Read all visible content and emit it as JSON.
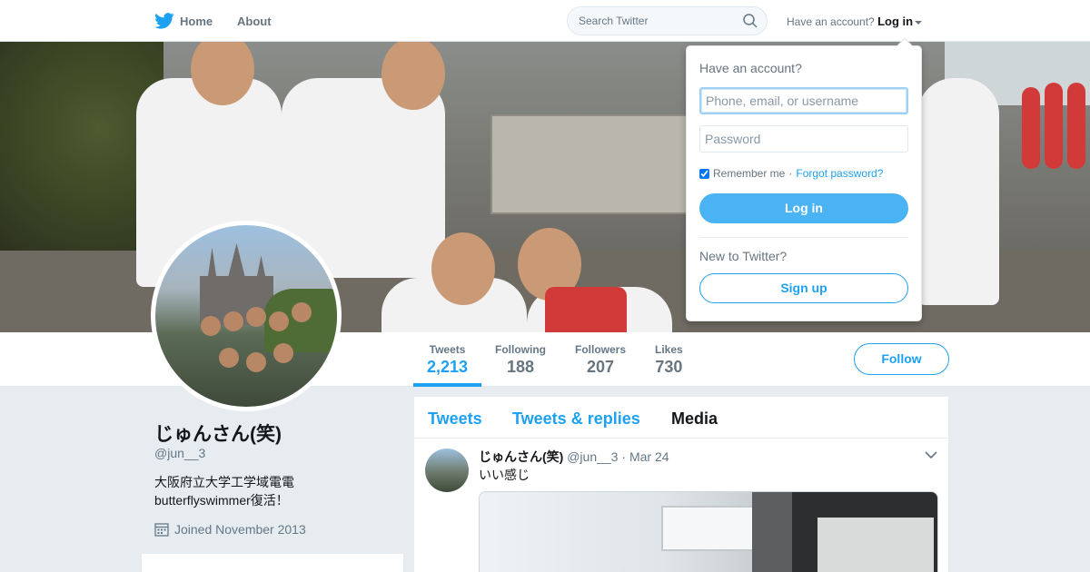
{
  "nav": {
    "home_label": "Home",
    "about_label": "About",
    "search_placeholder": "Search Twitter",
    "have_account_text": "Have an account?",
    "login_label": "Log in"
  },
  "profile": {
    "name": "じゅんさん(笑)",
    "handle": "@jun__3",
    "bio_line1": "大阪府立大学工学域電電",
    "bio_line2": "butterflyswimmer復活！",
    "joined": "Joined November 2013"
  },
  "stats": [
    {
      "label": "Tweets",
      "value": "2,213",
      "active": true
    },
    {
      "label": "Following",
      "value": "188"
    },
    {
      "label": "Followers",
      "value": "207"
    },
    {
      "label": "Likes",
      "value": "730"
    }
  ],
  "follow_label": "Follow",
  "timeline": {
    "tabs": [
      {
        "label": "Tweets"
      },
      {
        "label": "Tweets & replies"
      },
      {
        "label": "Media",
        "active": true
      }
    ],
    "tweet": {
      "name": "じゅんさん(笑)",
      "handle": "@jun__3",
      "separator": "·",
      "date": "Mar 24",
      "text": "いい感じ"
    }
  },
  "login_dropdown": {
    "title": "Have an account?",
    "username_placeholder": "Phone, email, or username",
    "password_placeholder": "Password",
    "remember_label": "Remember me",
    "dot": "·",
    "forgot_label": "Forgot password?",
    "login_button": "Log in",
    "new_text": "New to Twitter?",
    "signup_button": "Sign up"
  },
  "colors": {
    "accent": "#1da1f2",
    "login_button_bg": "#4ab3f4",
    "page_bg": "#e6ecf0"
  }
}
